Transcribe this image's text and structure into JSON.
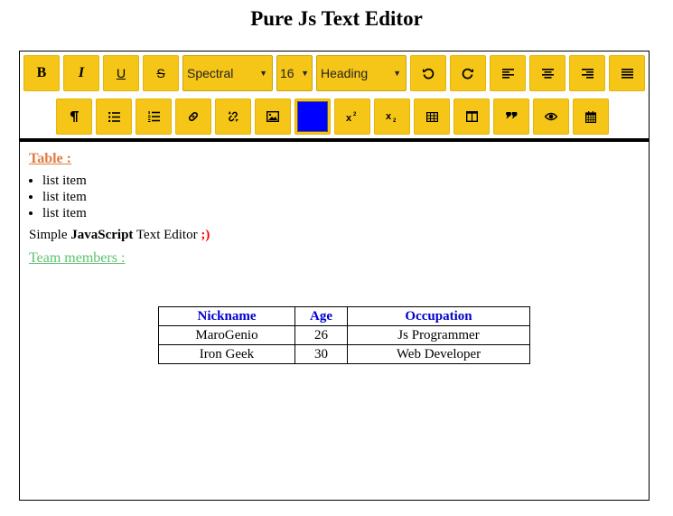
{
  "title": "Pure Js Text Editor",
  "toolbar": {
    "bold_label": "B",
    "italic_label": "I",
    "underline_label": "U",
    "strike_label": "S",
    "font_select": "Spectral",
    "size_select": "16",
    "heading_select": "Heading",
    "text_color": "#0000ff",
    "accent": "#f5c518"
  },
  "content": {
    "table_heading": "Table :",
    "list_items": [
      "list item",
      "list item",
      "list item"
    ],
    "simple_prefix": "Simple ",
    "simple_bold": "JavaScript",
    "simple_suffix": " Text Editor ",
    "smiley": ";)",
    "team_heading": "Team members :",
    "table": {
      "headers": [
        "Nickname",
        "Age",
        "Occupation"
      ],
      "rows": [
        [
          "MaroGenio",
          "26",
          "Js Programmer"
        ],
        [
          "Iron Geek",
          "30",
          "Web Developer"
        ]
      ]
    }
  }
}
